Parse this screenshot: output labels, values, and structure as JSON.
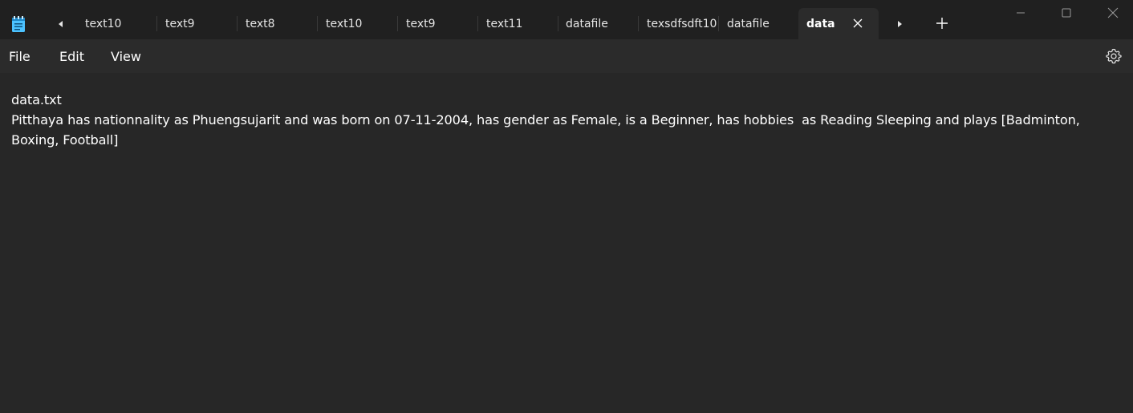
{
  "icons": {
    "app": "notepad-icon",
    "scroll_left": "caret-left-icon",
    "scroll_right": "caret-right-icon",
    "tab_close": "close-icon",
    "new_tab": "plus-icon",
    "minimize": "minimize-icon",
    "maximize": "maximize-icon",
    "close_window": "close-icon",
    "settings": "gear-icon"
  },
  "tabs": [
    {
      "label": "text10"
    },
    {
      "label": "text9"
    },
    {
      "label": "text8"
    },
    {
      "label": "text10"
    },
    {
      "label": "text9"
    },
    {
      "label": "text11"
    },
    {
      "label": "datafile"
    },
    {
      "label": "texsdfsdft10"
    },
    {
      "label": "datafile"
    },
    {
      "label": "data",
      "active": true
    }
  ],
  "menu": {
    "file": "File",
    "edit": "Edit",
    "view": "View"
  },
  "editor": {
    "content": "data.txt\nPitthaya has nationnality as Phuengsujarit and was born on 07-11-2004, has gender as Female, is a Beginner, has hobbies  as Reading Sleeping and plays [Badminton, Boxing, Football]"
  },
  "colors": {
    "titlebar_bg": "#202020",
    "menubar_bg": "#2b2b2b",
    "editor_bg": "#272727",
    "active_tab_bg": "#2b2b2b",
    "text": "#ffffff",
    "app_icon_accent": "#4cc2ff"
  }
}
